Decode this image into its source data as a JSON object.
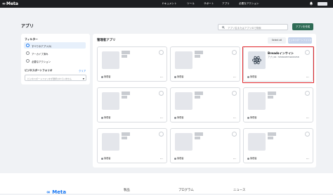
{
  "header": {
    "logo": "Meta",
    "nav": [
      "ドキュメント",
      "ツール",
      "サポート",
      "アプリ",
      "必要なアクション"
    ]
  },
  "page": {
    "title": "アプリ",
    "search_placeholder": "アプリ名またはアプリIDで検索",
    "create_button": "アプリを作成"
  },
  "filters": {
    "title": "フィルター",
    "options": [
      {
        "label": "すべてのアプリ(0)",
        "selected": true
      },
      {
        "label": "アーカイブ済み",
        "selected": false
      },
      {
        "label": "必要なアクション",
        "selected": false
      }
    ],
    "bp_title": "ビジネスポートフォリオ",
    "clear": "クリア",
    "bp_placeholder": "ビジネスポートフォリオが選択されていません"
  },
  "apps": {
    "title": "管理者アプリ",
    "select_all": "Select all",
    "add_to_bp": "ビジネスポートフォリオに追加",
    "role": "管理者",
    "more": "···",
    "featured": {
      "name": "Breadsインサイト",
      "id": "アプリID: 7658908759695058"
    }
  }
}
